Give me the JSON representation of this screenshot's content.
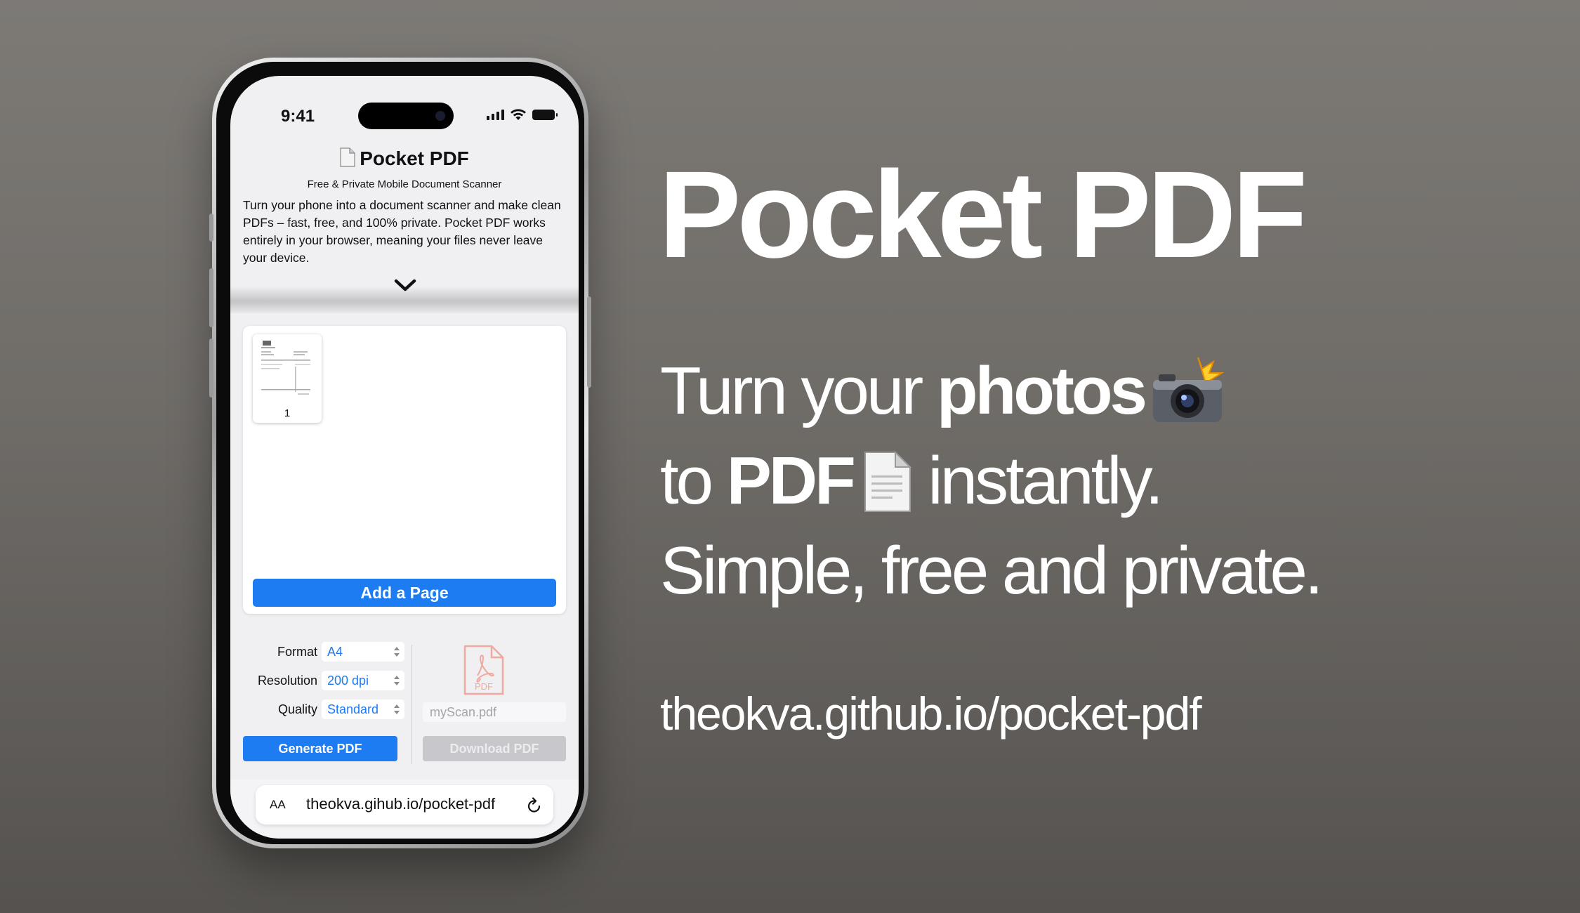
{
  "status_bar": {
    "time": "9:41"
  },
  "app": {
    "title": "Pocket PDF",
    "subtitle": "Free & Private Mobile Document Scanner",
    "intro": "Turn your phone into a document scanner and make clean PDFs – fast, free, and 100% private. Pocket PDF works entirely in your browser, meaning your files never leave your device.",
    "pages": [
      {
        "number": "1"
      }
    ],
    "add_page_label": "Add a Page",
    "settings": {
      "format": {
        "label": "Format",
        "value": "A4"
      },
      "resolution": {
        "label": "Resolution",
        "value": "200 dpi"
      },
      "quality": {
        "label": "Quality",
        "value": "Standard"
      }
    },
    "pdf_icon_label": "PDF",
    "filename_placeholder": "myScan.pdf",
    "generate_label": "Generate PDF",
    "download_label": "Download PDF",
    "accent_color": "#1e7cf2"
  },
  "safari": {
    "aa_label": "AA",
    "url": "theokva.gihub.io/pocket-pdf",
    "icons": [
      "back-icon",
      "forward-icon",
      "share-icon",
      "bookmarks-icon",
      "tabs-icon"
    ]
  },
  "marketing": {
    "title": "Pocket PDF",
    "line1_a": "Turn your ",
    "line1_b": "photos",
    "line2_a": "to ",
    "line2_b": "PDF",
    "line2_c": " instantly.",
    "line3": "Simple, free and private.",
    "url": "theokva.github.io/pocket-pdf"
  }
}
